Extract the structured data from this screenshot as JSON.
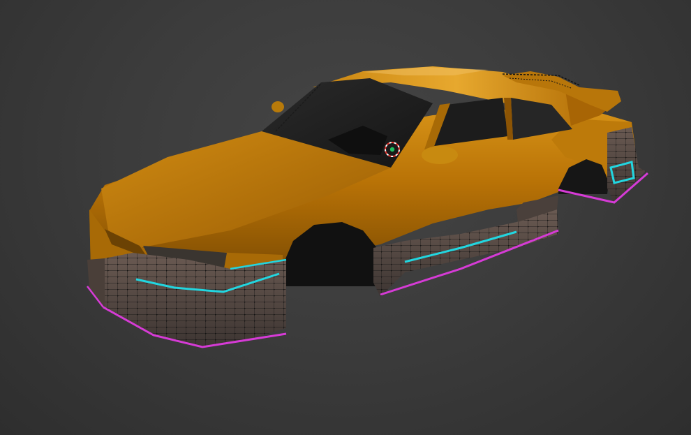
{
  "viewport": {
    "mode": "3d-edit",
    "object": "car-body",
    "body_color": "#C07A05",
    "edit_colors": {
      "mesh_wire": "#111111",
      "seam_cyan": "#22D6E0",
      "seam_magenta": "#D63BD6"
    },
    "icons": [
      "3d-cursor-icon"
    ]
  }
}
